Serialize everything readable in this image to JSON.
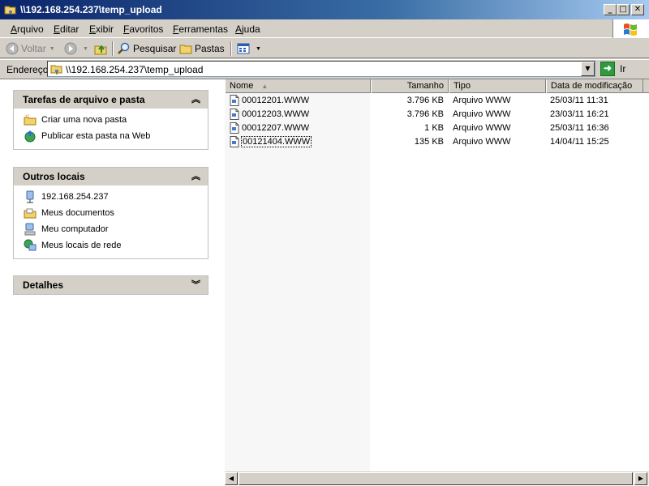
{
  "window": {
    "title": "\\\\192.168.254.237\\temp_upload"
  },
  "menu": [
    "Arquivo",
    "Editar",
    "Exibir",
    "Favoritos",
    "Ferramentas",
    "Ajuda"
  ],
  "toolbar": {
    "back": "Voltar",
    "search": "Pesquisar",
    "folders": "Pastas"
  },
  "address": {
    "label": "Endereço",
    "value": "\\\\192.168.254.237\\temp_upload",
    "go": "Ir"
  },
  "panels": {
    "tasks": {
      "title": "Tarefas de arquivo e pasta",
      "items": [
        "Criar uma nova pasta",
        "Publicar esta pasta na Web"
      ]
    },
    "places": {
      "title": "Outros locais",
      "items": [
        "192.168.254.237",
        "Meus documentos",
        "Meu computador",
        "Meus locais de rede"
      ]
    },
    "details": {
      "title": "Detalhes"
    }
  },
  "columns": {
    "name": "Nome",
    "size": "Tamanho",
    "type": "Tipo",
    "date": "Data de modificação"
  },
  "files": [
    {
      "name": "00012201.WWW",
      "size": "3.796 KB",
      "type": "Arquivo WWW",
      "date": "25/03/11 11:31"
    },
    {
      "name": "00012203.WWW",
      "size": "3.796 KB",
      "type": "Arquivo WWW",
      "date": "23/03/11 16:21"
    },
    {
      "name": "00012207.WWW",
      "size": "1 KB",
      "type": "Arquivo WWW",
      "date": "25/03/11 16:36"
    },
    {
      "name": "00121404.WWW",
      "size": "135 KB",
      "type": "Arquivo WWW",
      "date": "14/04/11 15:25"
    }
  ],
  "colors": {
    "title_bar_start": "#0a246a",
    "title_bar_end": "#a6caf0",
    "panel_header": "#d4d0c8"
  }
}
